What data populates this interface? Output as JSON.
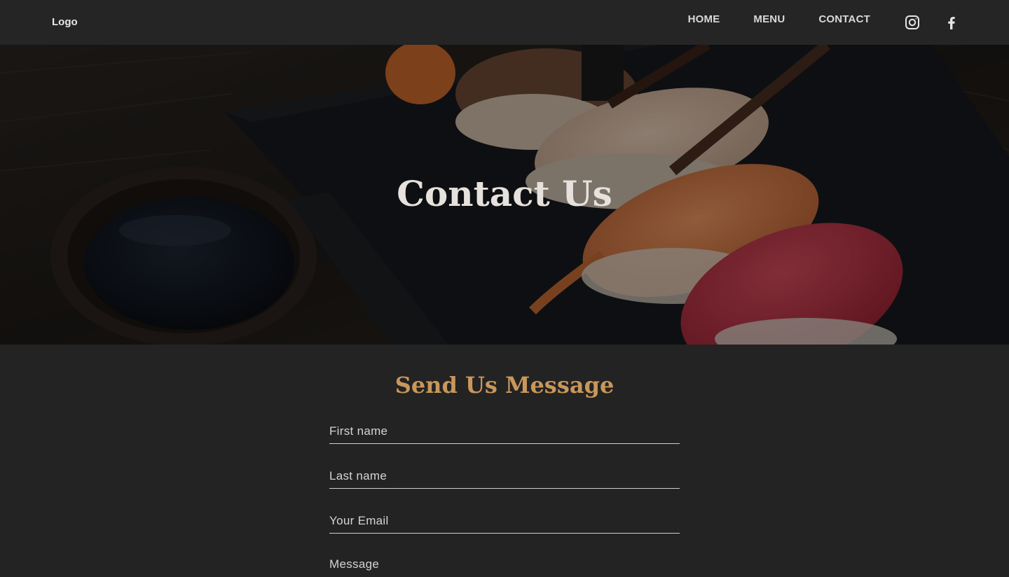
{
  "header": {
    "logo": "Logo",
    "nav": {
      "home": "HOME",
      "menu": "MENU",
      "contact": "CONTACT"
    },
    "social": {
      "instagram_icon": "instagram-icon",
      "facebook_icon": "facebook-icon"
    }
  },
  "hero": {
    "title": "Contact Us"
  },
  "form": {
    "title": "Send Us Message",
    "first_name_placeholder": "First name",
    "last_name_placeholder": "Last name",
    "email_placeholder": "Your Email",
    "message_placeholder": "Message"
  },
  "colors": {
    "header_bg": "#252525",
    "page_bg": "#232323",
    "accent": "#c9975a",
    "text_light": "#d9d9d9"
  }
}
